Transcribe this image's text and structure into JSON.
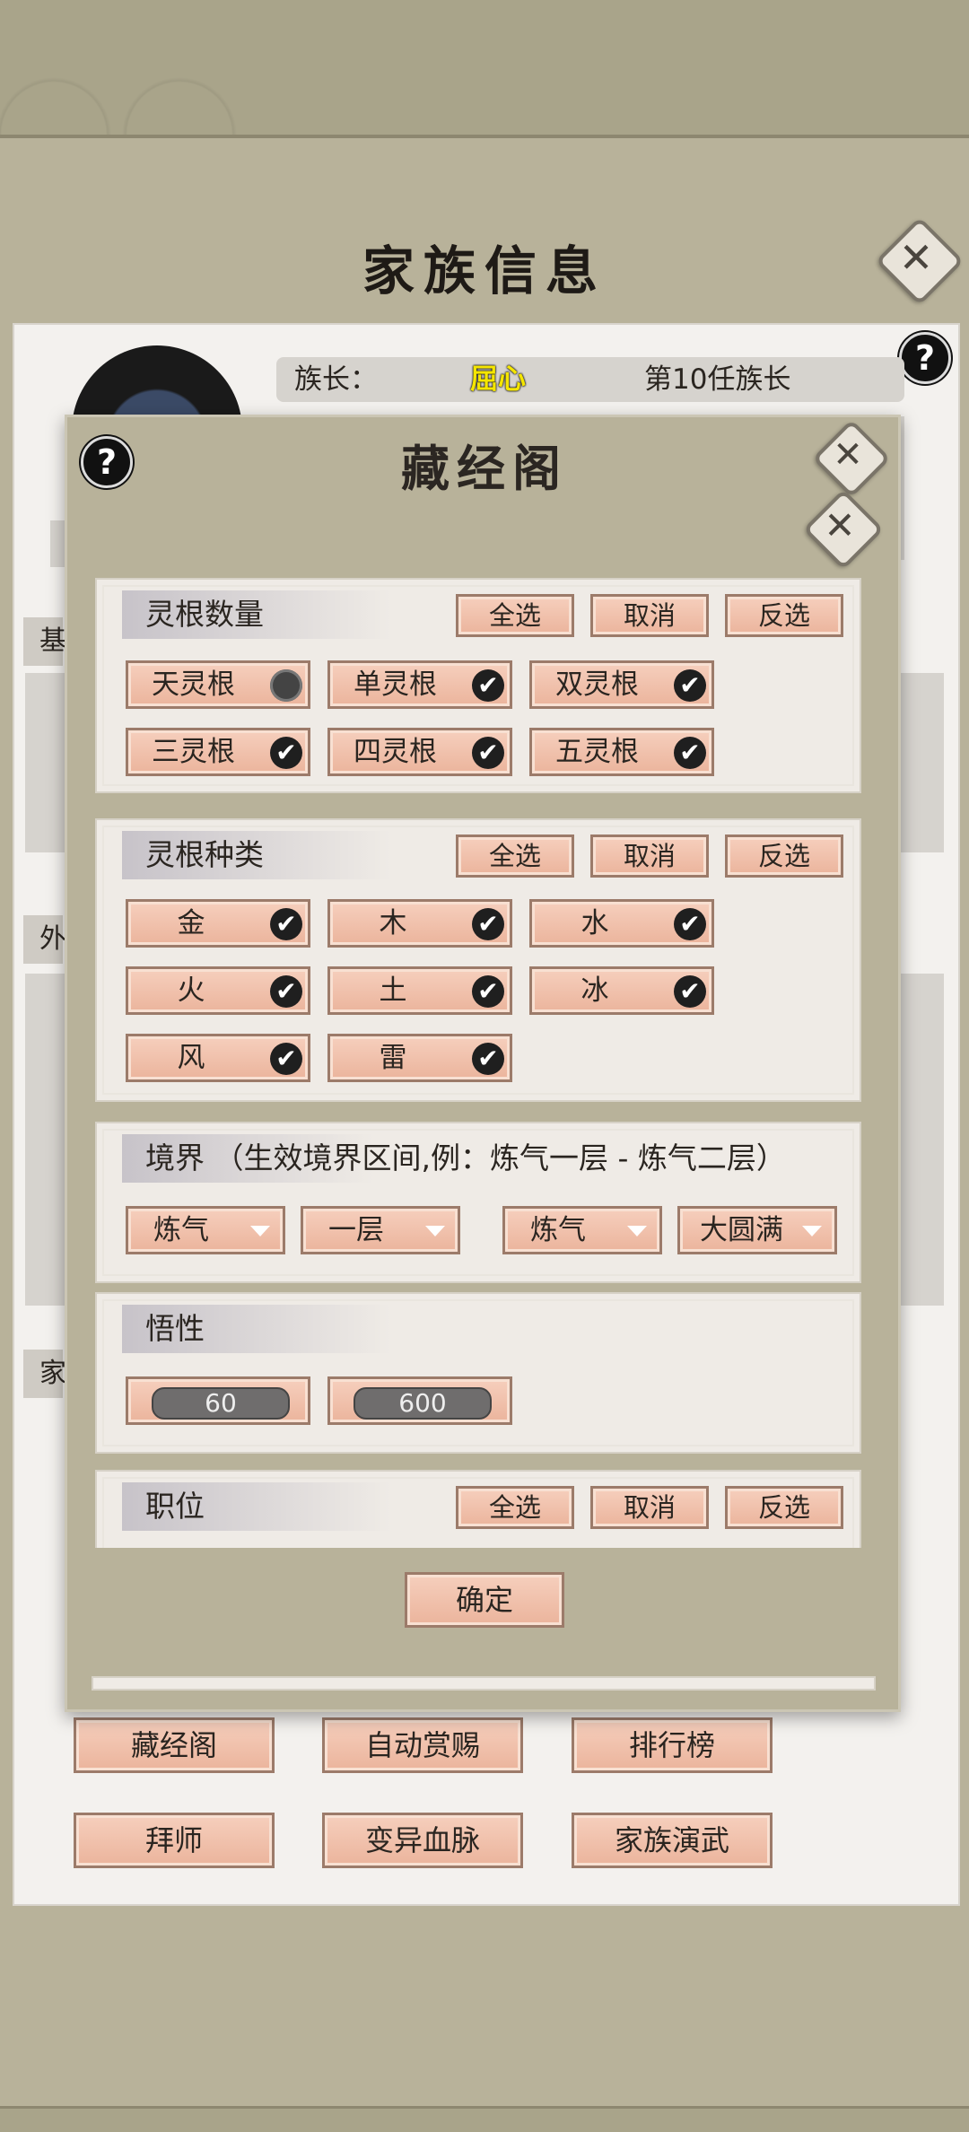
{
  "background": {
    "title": "家族信息",
    "leader_label": "族长：",
    "leader_name": "屈心",
    "leader_rank": "第10任族长",
    "side_tabs": [
      "基",
      "外",
      "家"
    ],
    "bottom_buttons": [
      [
        "藏经阁",
        "自动赏赐",
        "排行榜"
      ],
      [
        "拜师",
        "变异血脉",
        "家族演武"
      ]
    ]
  },
  "modal": {
    "title": "藏经阁",
    "confirm_label": "确定",
    "root_count": {
      "header": "灵根数量",
      "select_all": "全选",
      "cancel": "取消",
      "invert": "反选",
      "options": [
        {
          "label": "天灵根",
          "checked": false
        },
        {
          "label": "单灵根",
          "checked": true
        },
        {
          "label": "双灵根",
          "checked": true
        },
        {
          "label": "三灵根",
          "checked": true
        },
        {
          "label": "四灵根",
          "checked": true
        },
        {
          "label": "五灵根",
          "checked": true
        }
      ]
    },
    "root_type": {
      "header": "灵根种类",
      "select_all": "全选",
      "cancel": "取消",
      "invert": "反选",
      "options": [
        {
          "label": "金",
          "checked": true
        },
        {
          "label": "木",
          "checked": true
        },
        {
          "label": "水",
          "checked": true
        },
        {
          "label": "火",
          "checked": true
        },
        {
          "label": "土",
          "checked": true
        },
        {
          "label": "冰",
          "checked": true
        },
        {
          "label": "风",
          "checked": true
        },
        {
          "label": "雷",
          "checked": true
        }
      ]
    },
    "realm": {
      "header": "境界 （生效境界区间,例：炼气一层 - 炼气二层）",
      "from_realm": "炼气",
      "from_level": "一层",
      "to_realm": "炼气",
      "to_level": "大圆满"
    },
    "comprehension": {
      "header": "悟性",
      "min": "60",
      "max": "600"
    },
    "position": {
      "header": "职位",
      "select_all": "全选",
      "cancel": "取消",
      "invert": "反选"
    }
  },
  "icons": {
    "close": "close-x-icon",
    "help": "question-mark-icon",
    "check": "checkmark-icon",
    "dropdown": "triangle-down-icon"
  }
}
